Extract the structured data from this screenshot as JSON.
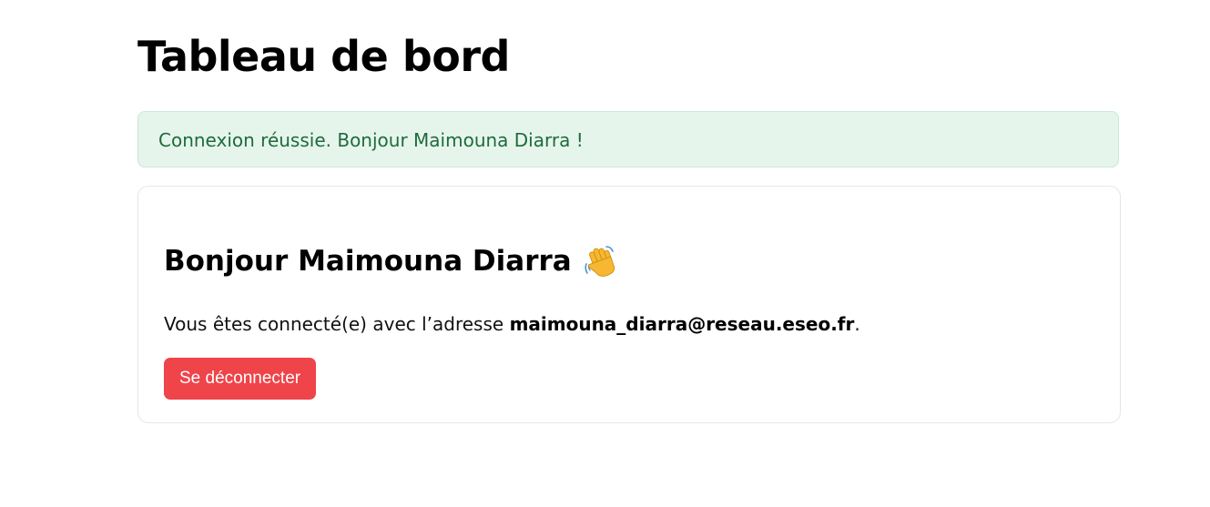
{
  "page": {
    "title": "Tableau de bord"
  },
  "alert": {
    "message": "Connexion réussie. Bonjour Maimouna Diarra !"
  },
  "card": {
    "greeting": "Bonjour Maimouna Diarra",
    "greeting_icon": "waving-hand-icon",
    "text_prefix": "Vous êtes connecté(e) avec l’adresse ",
    "email": "maimouna_diarra@reseau.eseo.fr",
    "text_suffix": ".",
    "logout_label": "Se déconnecter"
  },
  "colors": {
    "alert_background": "#e6f5ec",
    "alert_text": "#1e6b3c",
    "logout_button": "#ef4449"
  }
}
